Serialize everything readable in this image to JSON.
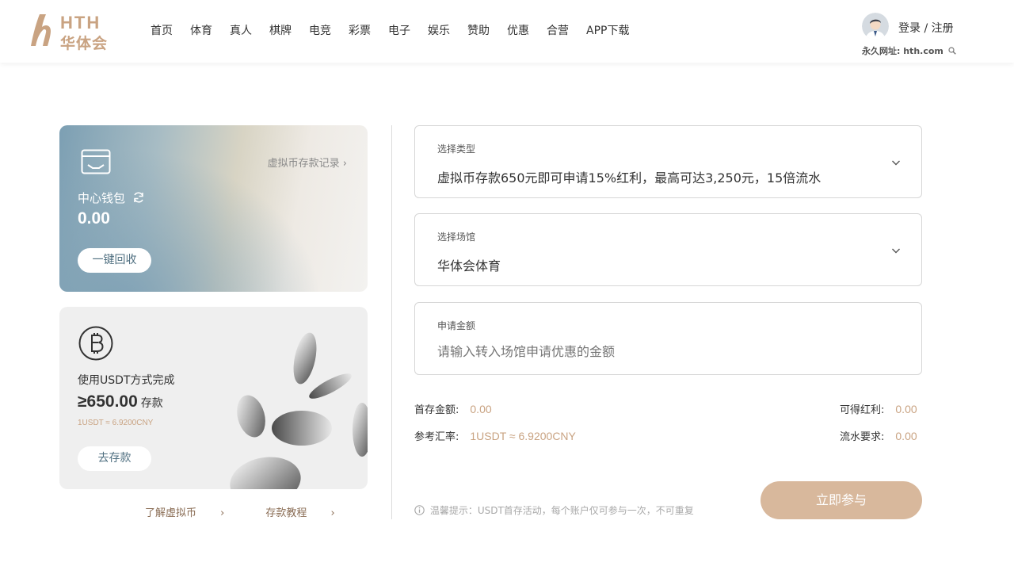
{
  "header": {
    "logo": {
      "brand_en": "HTH",
      "brand_cn": "华体会"
    },
    "nav": [
      "首页",
      "体育",
      "真人",
      "棋牌",
      "电竞",
      "彩票",
      "电子",
      "娱乐",
      "赞助",
      "优惠",
      "合营",
      "APP下载"
    ],
    "login_label": "登录 / 注册",
    "permanent_url": "永久网址: hth.com"
  },
  "wallet": {
    "record_link": "虚拟币存款记录",
    "label": "中心钱包",
    "amount": "0.00",
    "recycle_button": "一键回收"
  },
  "usdt_card": {
    "text": "使用USDT方式完成",
    "amount": "≥650.00",
    "amount_suffix": "存款",
    "rate": "1USDT ≈ 6.9200CNY",
    "deposit_button": "去存款"
  },
  "bottom_links": {
    "learn": "了解虚拟币",
    "tutorial": "存款教程"
  },
  "form": {
    "type_field": {
      "label": "选择类型",
      "value": "虚拟币存款650元即可申请15%红利，最高可达3,250元，15倍流水"
    },
    "venue_field": {
      "label": "选择场馆",
      "value": "华体会体育"
    },
    "amount_field": {
      "label": "申请金额",
      "placeholder": "请输入转入场馆申请优惠的金额"
    }
  },
  "summary": {
    "first_deposit_label": "首存金额:",
    "first_deposit_value": "0.00",
    "rate_label": "参考汇率:",
    "rate_value": "1USDT ≈ 6.9200CNY",
    "bonus_label": "可得红利:",
    "bonus_value": "0.00",
    "turnover_label": "流水要求:",
    "turnover_value": "0.00"
  },
  "tip": "温馨提示：USDT首存活动，每个账户仅可参与一次，不可重复",
  "join_button": "立即参与",
  "colors": {
    "accent": "#c9a382",
    "button_gold": "#d8b89c",
    "wallet_blue": "#7c9fb3"
  }
}
